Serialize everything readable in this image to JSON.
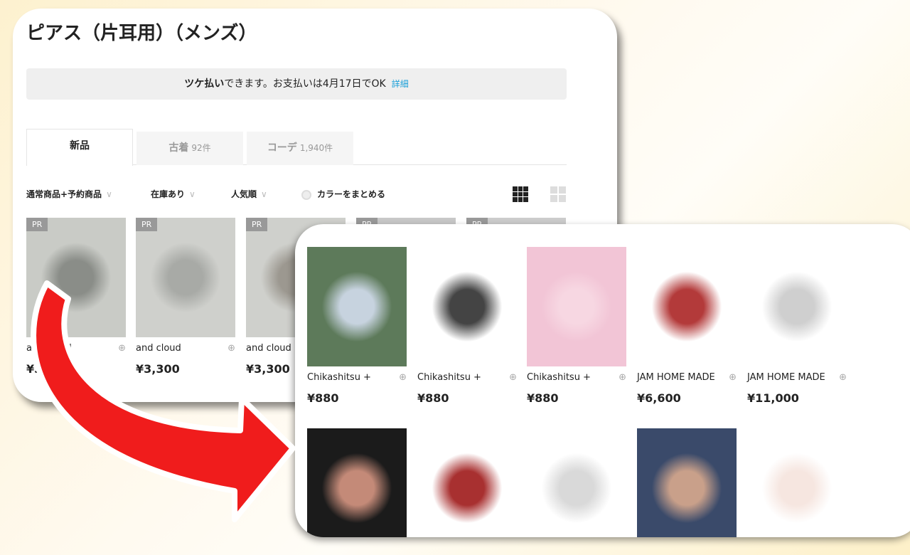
{
  "page_title": "ピアス（片耳用）（メンズ）",
  "banner": {
    "bold": "ツケ払い",
    "text": "できます。お支払いは4月17日でOK",
    "link": "詳細"
  },
  "tabs": [
    {
      "label": "新品",
      "count": ""
    },
    {
      "label": "古着",
      "count": "92件"
    },
    {
      "label": "コーデ",
      "count": "1,940件"
    }
  ],
  "filters": {
    "type": "通常商品+予約商品",
    "stock": "在庫あり",
    "sort": "人気順",
    "color_group": "カラーをまとめる"
  },
  "pr_badge": "PR",
  "products_top": [
    {
      "brand": "and cloud",
      "price": "¥3,300",
      "colors": [
        "#c9cbc6",
        "#8a8d88"
      ]
    },
    {
      "brand": "and cloud",
      "price": "¥3,300",
      "colors": [
        "#cfd0cc",
        "#a8aaa6"
      ]
    },
    {
      "brand": "and cloud",
      "price": "¥3,300",
      "colors": [
        "#cfd0cc",
        "#9c9890"
      ]
    },
    {
      "brand": "",
      "price": "",
      "colors": [
        "#c8c8c8",
        "#b0b0b0"
      ]
    },
    {
      "brand": "",
      "price": "",
      "colors": [
        "#cccccc",
        "#b5b5b5"
      ]
    }
  ],
  "products_bottom": [
    {
      "brand": "Chikashitsu +",
      "price": "¥880",
      "colors": [
        "#5d7a5a",
        "#c7d3df"
      ]
    },
    {
      "brand": "Chikashitsu +",
      "price": "¥880",
      "colors": [
        "#ffffff",
        "#444444"
      ]
    },
    {
      "brand": "Chikashitsu +",
      "price": "¥880",
      "colors": [
        "#f2c5d6",
        "#f7d7e2"
      ]
    },
    {
      "brand": "JAM HOME MADE",
      "price": "¥6,600",
      "colors": [
        "#ffffff",
        "#b33a3a"
      ]
    },
    {
      "brand": "JAM HOME MADE",
      "price": "¥11,000",
      "colors": [
        "#ffffff",
        "#cfcfcf"
      ]
    }
  ],
  "products_row3": [
    {
      "colors": [
        "#1b1b1b",
        "#c48a78"
      ]
    },
    {
      "colors": [
        "#ffffff",
        "#a83030"
      ]
    },
    {
      "colors": [
        "#ffffff",
        "#d9d9d9"
      ]
    },
    {
      "colors": [
        "#3a4a6a",
        "#c9a08a"
      ]
    },
    {
      "colors": [
        "#ffffff",
        "#f6e6e0"
      ]
    }
  ],
  "arrow_color": "#f01c1c"
}
